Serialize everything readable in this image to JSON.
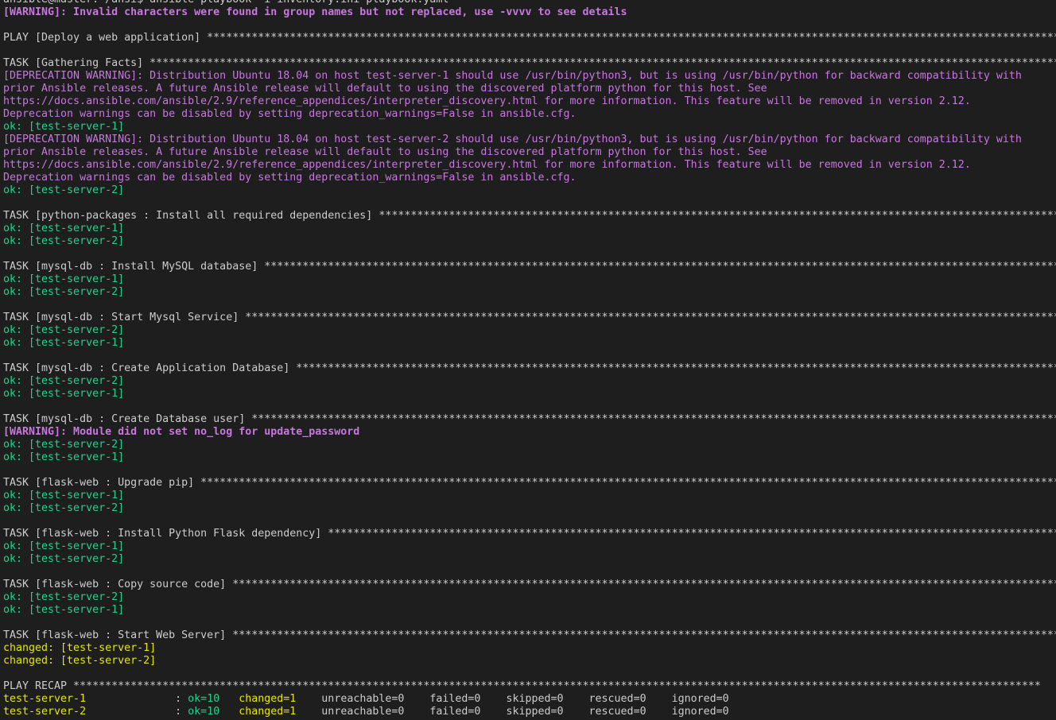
{
  "prompt_line": "ansible@master:~/ansi$ ansible-playbook -i inventory.ini playbook.yaml",
  "warning_groups": "[WARNING]: Invalid characters were found in group names but not replaced, use -vvvv to see details",
  "play_header": "PLAY [Deploy a web application] ******************************************************************************************************************************************",
  "tasks": {
    "gathering": {
      "header": "TASK [Gathering Facts] ****************************************************************************************************************************************************",
      "dep1_l1": "[DEPRECATION WARNING]: Distribution Ubuntu 18.04 on host test-server-1 should use /usr/bin/python3, but is using /usr/bin/python for backward compatibility with",
      "dep1_l2": "prior Ansible releases. A future Ansible release will default to using the discovered platform python for this host. See",
      "dep1_l3": "https://docs.ansible.com/ansible/2.9/reference_appendices/interpreter_discovery.html for more information. This feature will be removed in version 2.12.",
      "dep1_l4": "Deprecation warnings can be disabled by setting deprecation_warnings=False in ansible.cfg.",
      "ok1": "ok: [test-server-1]",
      "dep2_l1": "[DEPRECATION WARNING]: Distribution Ubuntu 18.04 on host test-server-2 should use /usr/bin/python3, but is using /usr/bin/python for backward compatibility with",
      "dep2_l2": "prior Ansible releases. A future Ansible release will default to using the discovered platform python for this host. See",
      "dep2_l3": "https://docs.ansible.com/ansible/2.9/reference_appendices/interpreter_discovery.html for more information. This feature will be removed in version 2.12.",
      "dep2_l4": "Deprecation warnings can be disabled by setting deprecation_warnings=False in ansible.cfg.",
      "ok2": "ok: [test-server-2]"
    },
    "python_packages": {
      "header": "TASK [python-packages : Install all required dependencies] ****************************************************************************************************************",
      "r1": "ok: [test-server-1]",
      "r2": "ok: [test-server-2]"
    },
    "mysql_install": {
      "header": "TASK [mysql-db : Install MySQL database] **********************************************************************************************************************************",
      "r1": "ok: [test-server-1]",
      "r2": "ok: [test-server-2]"
    },
    "mysql_start": {
      "header": "TASK [mysql-db : Start Mysql Service] *************************************************************************************************************************************",
      "r1": "ok: [test-server-2]",
      "r2": "ok: [test-server-1]"
    },
    "mysql_create_db": {
      "header": "TASK [mysql-db : Create Application Database] *****************************************************************************************************************************",
      "r1": "ok: [test-server-2]",
      "r2": "ok: [test-server-1]"
    },
    "mysql_create_user": {
      "header": "TASK [mysql-db : Create Database user] ************************************************************************************************************************************",
      "warning": "[WARNING]: Module did not set no_log for update_password",
      "r1": "ok: [test-server-2]",
      "r2": "ok: [test-server-1]"
    },
    "flask_pip": {
      "header": "TASK [flask-web : Upgrade pip] ********************************************************************************************************************************************",
      "r1": "ok: [test-server-1]",
      "r2": "ok: [test-server-2]"
    },
    "flask_dep": {
      "header": "TASK [flask-web : Install Python Flask dependency] ************************************************************************************************************************",
      "r1": "ok: [test-server-1]",
      "r2": "ok: [test-server-2]"
    },
    "flask_copy": {
      "header": "TASK [flask-web : Copy source code] ***************************************************************************************************************************************",
      "r1": "ok: [test-server-2]",
      "r2": "ok: [test-server-1]"
    },
    "flask_start": {
      "header": "TASK [flask-web : Start Web Server] ***************************************************************************************************************************************",
      "r1": "changed: [test-server-1]",
      "r2": "changed: [test-server-2]"
    }
  },
  "recap": {
    "header": "PLAY RECAP ********************************************************************************************************************************************************",
    "hosts": [
      {
        "host": "test-server-1",
        "sep": "              : ",
        "ok": "ok=10",
        "changed": "   changed=1",
        "rest": "    unreachable=0    failed=0    skipped=0    rescued=0    ignored=0"
      },
      {
        "host": "test-server-2",
        "sep": "              : ",
        "ok": "ok=10",
        "changed": "   changed=1",
        "rest": "    unreachable=0    failed=0    skipped=0    rescued=0    ignored=0"
      }
    ]
  },
  "colors": {
    "background": "#1e1e1e",
    "text": "#cccccc",
    "warning": "#c678dd",
    "ok": "#23d18b",
    "changed": "#e5e510"
  }
}
